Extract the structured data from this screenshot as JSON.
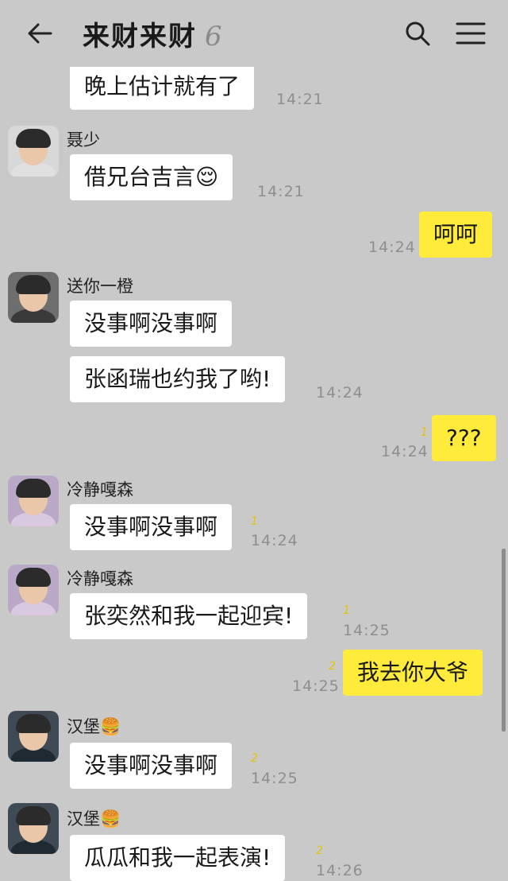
{
  "header": {
    "title": "来财来财",
    "member_count": "6"
  },
  "messages": [
    {
      "text": "晚上估计就有了",
      "time": "14:21"
    },
    {
      "sender": "聂少",
      "text": "借兄台吉言😌",
      "time": "14:21"
    },
    {
      "text": "呵呵",
      "time": "14:24"
    },
    {
      "sender": "送你一橙",
      "text": "没事啊没事啊"
    },
    {
      "text": "张函瑞也约我了哟!",
      "time": "14:24"
    },
    {
      "text": "???",
      "time": "14:24",
      "read": "1"
    },
    {
      "sender": "冷静嘎森",
      "text": "没事啊没事啊",
      "time": "14:24",
      "read": "1"
    },
    {
      "sender": "冷静嘎森",
      "text": "张奕然和我一起迎宾!",
      "time": "14:25",
      "read": "1"
    },
    {
      "text": "我去你大爷",
      "time": "14:25",
      "read": "2"
    },
    {
      "sender": "汉堡🍔",
      "text": "没事啊没事啊",
      "time": "14:25",
      "read": "2"
    },
    {
      "sender": "汉堡🍔",
      "text": "瓜瓜和我一起表演!",
      "time": "14:26",
      "read": "2"
    }
  ]
}
